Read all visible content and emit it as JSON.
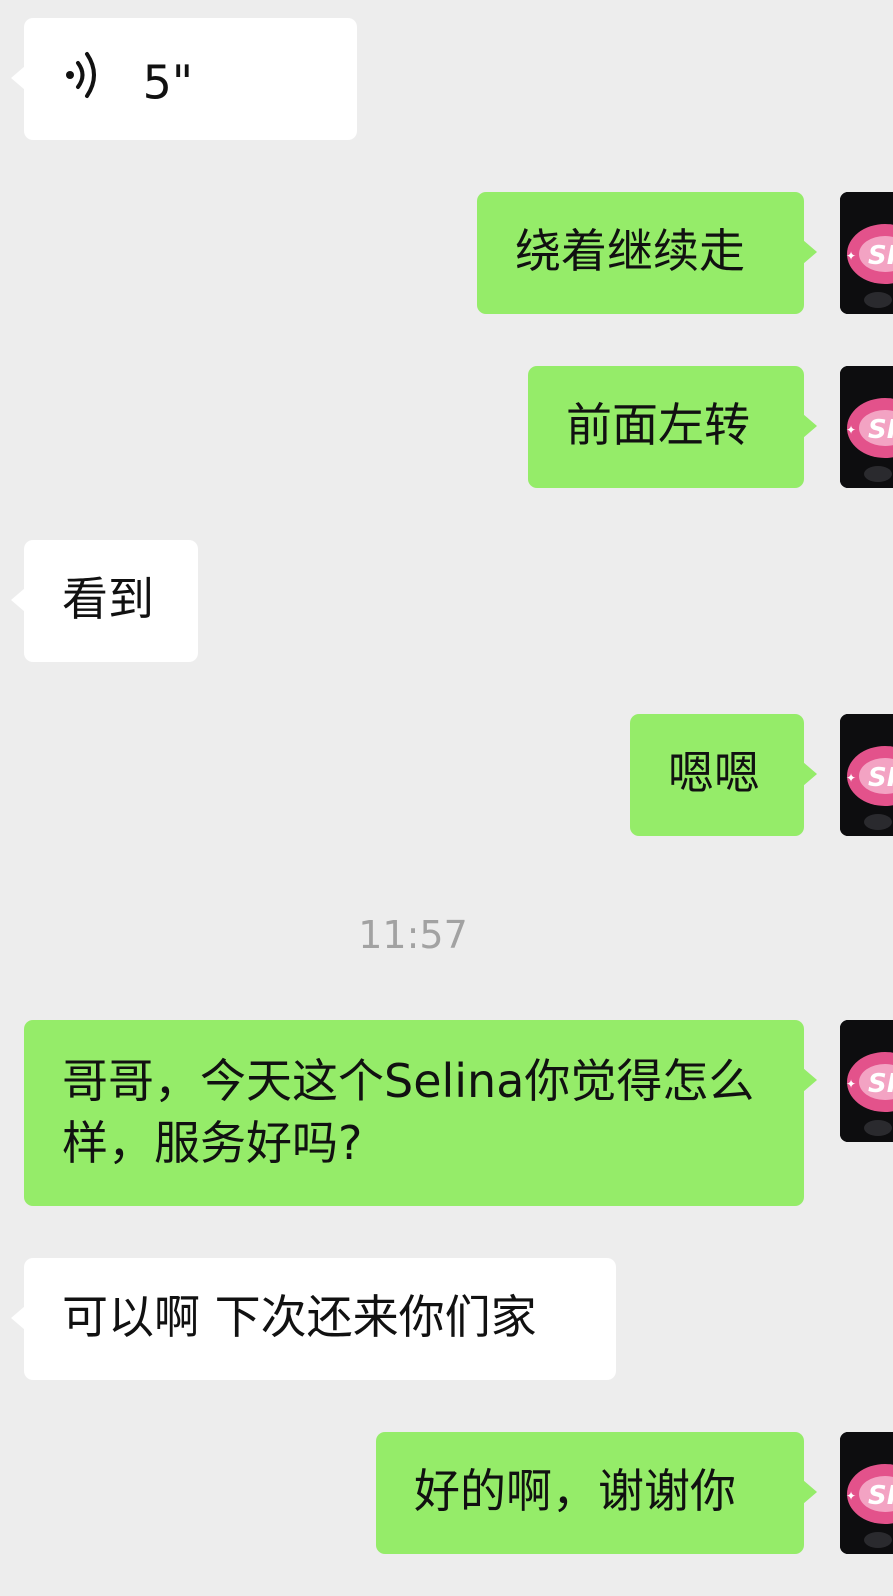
{
  "messages": [
    {
      "side": "in",
      "type": "voice",
      "duration": "5\""
    },
    {
      "side": "out",
      "text": "绕着继续走"
    },
    {
      "side": "out",
      "text": "前面左转"
    },
    {
      "side": "in",
      "text": "看到"
    },
    {
      "side": "out",
      "text": "嗯嗯"
    },
    {
      "timestamp": "11:57"
    },
    {
      "side": "out",
      "text": "哥哥，今天这个Selina你觉得怎么样，服务好吗?"
    },
    {
      "side": "in",
      "text": "可以啊 下次还来你们家"
    },
    {
      "side": "out",
      "text": "好的啊，谢谢你"
    }
  ],
  "colors": {
    "background": "#ededed",
    "incoming_bubble": "#ffffff",
    "outgoing_bubble": "#95ec69",
    "timestamp": "#a2a2a2"
  },
  "icons": {
    "voice": "voice-wave-icon",
    "avatar": "user-avatar"
  }
}
